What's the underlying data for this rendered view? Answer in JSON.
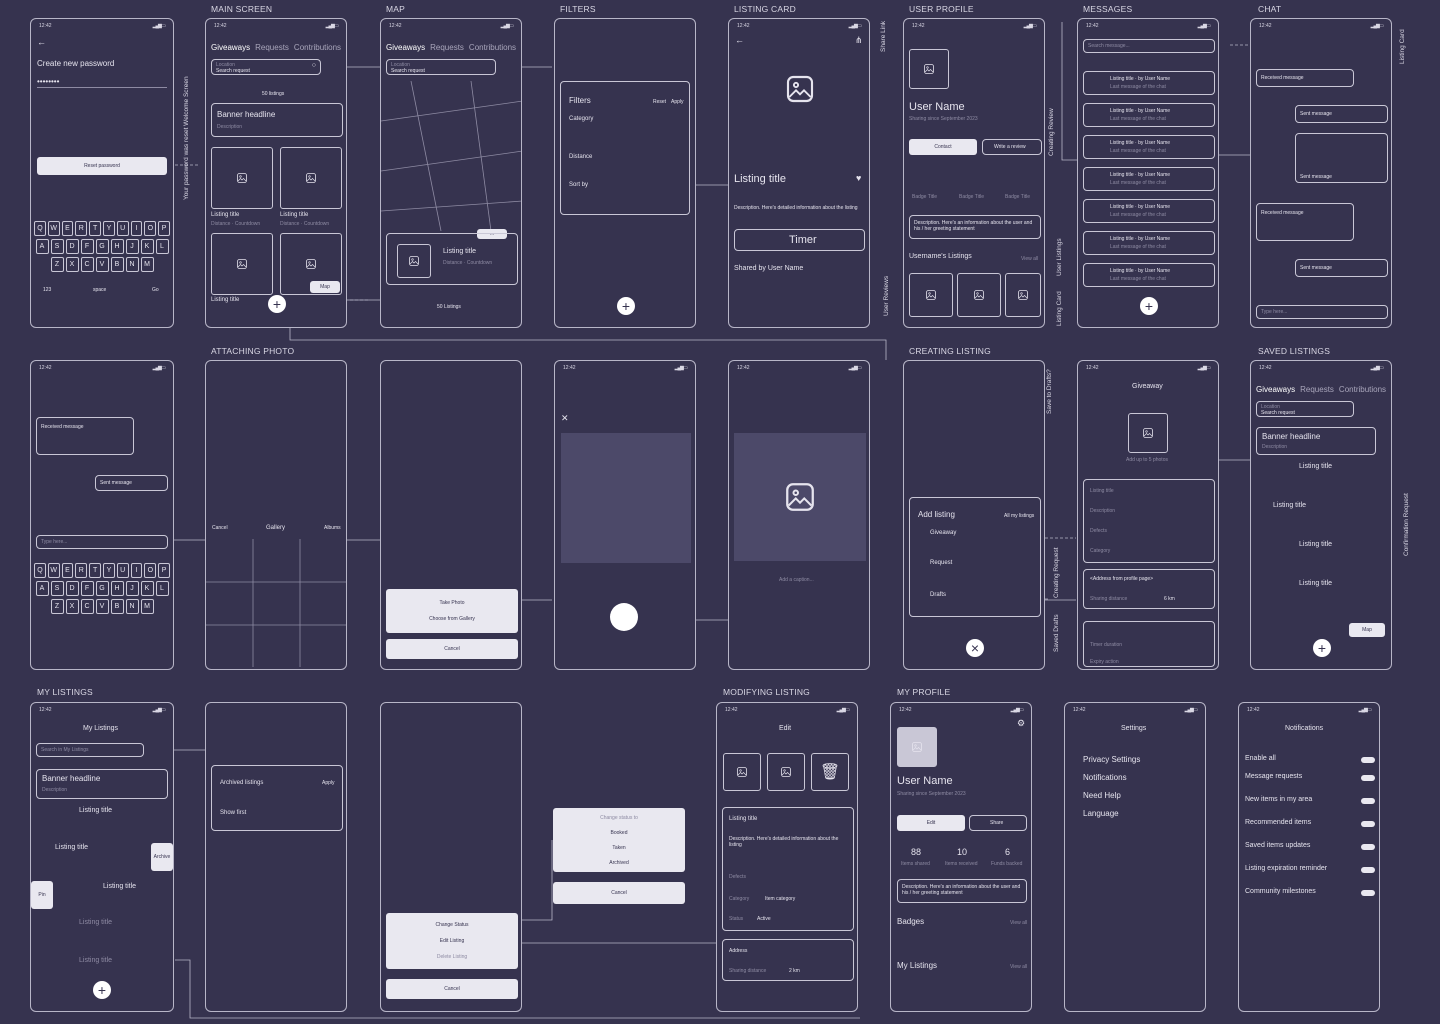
{
  "sections": {
    "main": "MAIN SCREEN",
    "map": "MAP",
    "filters": "FILTERS",
    "listing": "LISTING CARD",
    "user": "USER PROFILE",
    "messages": "MESSAGES",
    "chat": "CHAT",
    "attach": "ATTACHING PHOTO",
    "creating": "CREATING LISTING",
    "saved": "SAVED LISTINGS",
    "mylist": "MY LISTINGS",
    "modify": "MODIFYING LISTING",
    "myprofile": "MY PROFILE"
  },
  "time": "12:42",
  "labels": {
    "create_pw": "Create new password",
    "pw_dots": "••••••••",
    "reset_pw": "Reset password",
    "pw_note": "Your password was reset Welcome Screen",
    "giveaways": "Giveaways",
    "requests": "Requests",
    "contributions": "Contributions",
    "location": "Location",
    "search_request": "Search request",
    "listings50": "50 listings",
    "listings50b": "50 Listings",
    "banner": "Banner headline",
    "description": "Description",
    "listing_title": "Listing title",
    "distance_countdown": "Distance · Countdown",
    "map": "Map",
    "filters": "Filters",
    "reset": "Reset",
    "apply": "Apply",
    "category": "Category",
    "distance": "Distance",
    "sort_by": "Sort by",
    "listing_desc": "Description. Here's detailed information about the listing",
    "timer": "Timer",
    "shared_by": "Shared by User Name",
    "user_name": "User Name",
    "sharing_since": "Sharing since September 2023",
    "contact": "Contact",
    "write_review": "Write a review",
    "badge_title": "Badge Title",
    "user_desc": "Description. Here's an information about the user and his / her greeting statement",
    "users_listings": "Username's Listings",
    "view_all": "View all",
    "search_message": "Search message...",
    "listing_user": "Listing title · by User Name",
    "last_message": "Last message of the chat",
    "received": "Received message",
    "sent": "Sent message",
    "type_here": "Type here...",
    "gallery": "Gallery",
    "cancel": "Cancel",
    "albums": "Albums",
    "take_photo": "Take Photo",
    "choose_gallery": "Choose from Gallery",
    "add_caption": "Add a caption...",
    "add_listing": "Add listing",
    "all_my_listings": "All my listings",
    "giveaway": "Giveaway",
    "request": "Request",
    "drafts": "Drafts",
    "add_photos": "Add up to 5 photos",
    "defects": "Defects",
    "address_profile": "<Address from profile page>",
    "sharing_distance": "Sharing distance",
    "km6": "6 km",
    "timer_duration": "Timer duration",
    "expiry": "Expiry action",
    "my_listings": "My Listings",
    "search_my": "Search in My Listings",
    "status": "Status",
    "archived_listings": "Archived listings",
    "show_first": "Show first",
    "archive": "Archive",
    "pin": "Pin",
    "delete": "Delete",
    "change_status": "Change Status",
    "edit_listing": "Edit Listing",
    "delete_listing": "Delete Listing",
    "change_status_to": "Change status to",
    "booked": "Booked",
    "taken": "Taken",
    "archived": "Archived",
    "edit": "Edit",
    "active": "Active",
    "item_category": "Item category",
    "address": "Address",
    "km2": "2 km",
    "share": "Share",
    "items_shared": "Items shared",
    "items_received": "Items received",
    "funds_backed": "Funds backed",
    "n88": "88",
    "n10": "10",
    "n6": "6",
    "badges": "Badges",
    "settings": "Settings",
    "privacy": "Privacy Settings",
    "notifications": "Notifications",
    "need_help": "Need Help",
    "language": "Language",
    "enable_all": "Enable all",
    "msg_requests": "Message requests",
    "new_items": "New items in my area",
    "recommended": "Recommended items",
    "saved_updates": "Saved items updates",
    "expiration": "Listing expiration reminder",
    "milestones": "Community milestones",
    "share_link": "Share Link",
    "creating_review": "Creating Review",
    "user_listings": "User Listings",
    "user_reviews": "User Reviews",
    "listing_card": "Listing Card",
    "save_drafts": "Save to Drafts?",
    "creating_request": "Creating Request",
    "saved_drafts": "Saved Drafts",
    "confirm_request": "Confirmation Request",
    "space": "space",
    "go": "Go",
    "n123": "123"
  },
  "keys": {
    "r1": [
      "Q",
      "W",
      "E",
      "R",
      "T",
      "Y",
      "U",
      "I",
      "O",
      "P"
    ],
    "r2": [
      "A",
      "S",
      "D",
      "F",
      "G",
      "H",
      "J",
      "K",
      "L"
    ],
    "r3": [
      "Z",
      "X",
      "C",
      "V",
      "B",
      "N",
      "M"
    ]
  }
}
